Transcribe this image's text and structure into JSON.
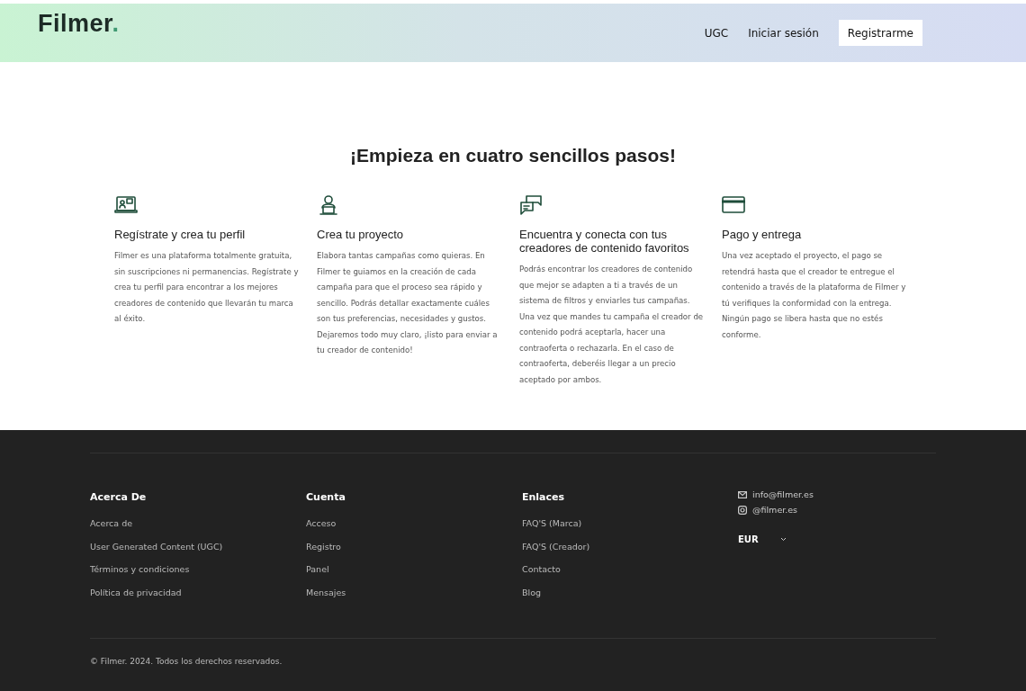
{
  "header": {
    "logo": {
      "name": "Filmer",
      "mark": "."
    },
    "nav": [
      {
        "kind": "link",
        "label": "UGC"
      },
      {
        "kind": "link",
        "label": "Iniciar sesión"
      },
      {
        "kind": "button",
        "label": "Registrarme"
      }
    ]
  },
  "steps_section": {
    "title": "¡Empieza en cuatro sencillos pasos!",
    "steps": [
      {
        "kind": "profile",
        "title": "Regístrate y crea tu perfil",
        "text": "Filmer es una plataforma totalmente gratuita, sin suscripciones ni permanencias. Regístrate y crea tu perfil para encontrar a los mejores creadores de contenido que llevarán tu marca al éxito."
      },
      {
        "kind": "person",
        "title": "Crea tu proyecto",
        "text": "Elabora tantas campañas como quieras. En Filmer te guiamos en la creación de cada campaña para que el proceso sea rápido y sencillo. Podrás detallar exactamente cuáles son tus preferencias, necesidades y gustos. Dejaremos todo muy claro, ¡listo para enviar a tu creador de contenido!"
      },
      {
        "kind": "chat",
        "title": "Encuentra y conecta con tus creadores de contenido favoritos",
        "text": "Podrás encontrar los creadores de contenido que mejor se adapten a ti a través de un sistema de filtros y enviarles tus campañas. Una vez que mandes tu campaña el creador de contenido podrá aceptarla, hacer una contraoferta o rechazarla. En el caso de contraoferta, deberéis llegar a un precio aceptado por ambos."
      },
      {
        "kind": "card",
        "title": "Pago y entrega",
        "text": "Una vez aceptado el proyecto, el pago se retendrá hasta que el creador te entregue el contenido a través de la plataforma de Filmer y tú verifiques la conformidad con la entrega. Ningún pago se libera hasta que no estés conforme."
      }
    ]
  },
  "footer": {
    "columns": [
      {
        "title": "Acerca De",
        "links": [
          "Acerca de",
          "User Generated Content (UGC)",
          "Términos y condiciones",
          "Política de privacidad"
        ]
      },
      {
        "title": "Cuenta",
        "links": [
          "Acceso",
          "Registro",
          "Panel",
          "Mensajes"
        ]
      },
      {
        "title": "Enlaces",
        "links": [
          "FAQ'S (Marca)",
          "FAQ'S (Creador)",
          "Contacto",
          "Blog"
        ]
      }
    ],
    "contacts": [
      {
        "kind": "email",
        "label": "info@filmer.es"
      },
      {
        "kind": "social",
        "label": "@filmer.es"
      }
    ],
    "currency": "EUR",
    "copyright": "© Filmer. 2024. Todos los derechos reservados."
  }
}
